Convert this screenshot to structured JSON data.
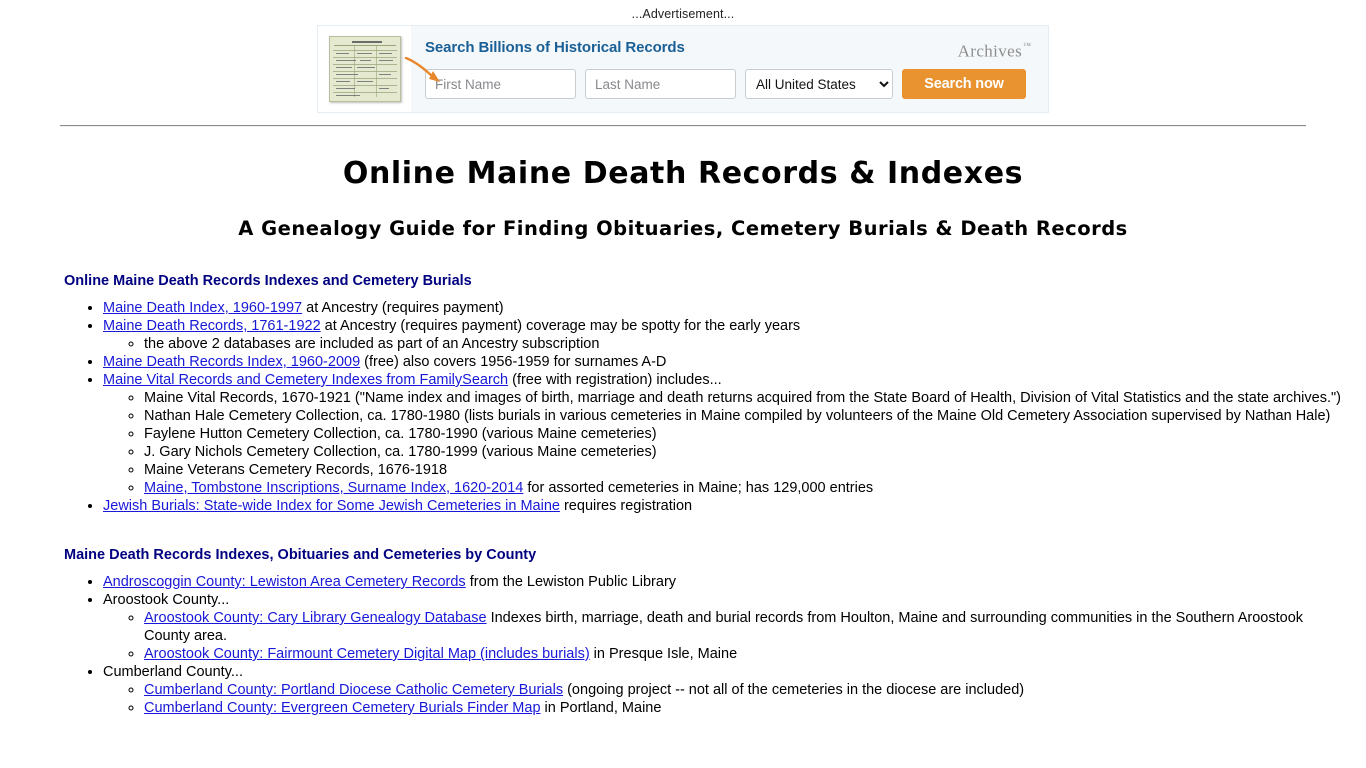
{
  "advertisement": {
    "label": "...Advertisement...",
    "headline": "Search Billions of Historical Records",
    "brand": "Archives",
    "brand_tm": "™",
    "first_name_placeholder": "First Name",
    "last_name_placeholder": "Last Name",
    "region_selected": "All United States",
    "region_options": [
      "All United States"
    ],
    "search_button": "Search now",
    "accent_color": "#e89330",
    "headline_color": "#1a6096",
    "panel_color": "#f4f8fb"
  },
  "page": {
    "title": "Online Maine Death Records & Indexes",
    "subtitle": "A Genealogy Guide for Finding Obituaries, Cemetery Burials & Death Records",
    "heading_color": "#000080",
    "link_color": "#1818d8"
  },
  "section1": {
    "heading": "Online Maine Death Records Indexes and Cemetery Burials",
    "items": [
      {
        "link": "Maine Death Index, 1960-1997",
        "text": " at Ancestry (requires payment)"
      },
      {
        "link": "Maine Death Records, 1761-1922",
        "text": " at Ancestry (requires payment) coverage may be spotty for the early years",
        "sub": [
          {
            "link": "",
            "text": "the above 2 databases are included as part of an Ancestry subscription"
          }
        ]
      },
      {
        "link": "Maine Death Records Index, 1960-2009",
        "text": " (free) also covers 1956-1959 for surnames A-D"
      },
      {
        "link": "Maine Vital Records and Cemetery Indexes from FamilySearch",
        "text": " (free with registration) includes...",
        "spaced": true,
        "sub": [
          {
            "link": "",
            "text": "Maine Vital Records, 1670-1921 (\"Name index and images of birth, marriage and death returns acquired from the State Board of Health, Division of Vital Statistics and the state archives.\")"
          },
          {
            "link": "",
            "text": "Nathan Hale Cemetery Collection, ca. 1780-1980 (lists burials in various cemeteries in Maine compiled by volunteers of the Maine Old Cemetery Association supervised by Nathan Hale)"
          },
          {
            "link": "",
            "text": "Faylene Hutton Cemetery Collection, ca. 1780-1990 (various Maine cemeteries)"
          },
          {
            "link": "",
            "text": "J. Gary Nichols Cemetery Collection, ca. 1780-1999 (various Maine cemeteries)"
          },
          {
            "link": "",
            "text": "Maine Veterans Cemetery Records, 1676-1918"
          },
          {
            "link": "Maine, Tombstone Inscriptions, Surname Index, 1620-2014",
            "text": " for assorted cemeteries in Maine; has 129,000 entries"
          }
        ]
      },
      {
        "link": "Jewish Burials: State-wide Index for Some Jewish Cemeteries in Maine",
        "text": " requires registration",
        "spaced": true
      }
    ]
  },
  "section2": {
    "heading": "Maine Death Records Indexes, Obituaries and Cemeteries by County",
    "items": [
      {
        "link": "Androscoggin County: Lewiston Area Cemetery Records",
        "text": " from the Lewiston Public Library"
      },
      {
        "link": "",
        "text": "Aroostook County...",
        "sub": [
          {
            "link": "Aroostook County: Cary Library Genealogy Database",
            "text": " Indexes birth, marriage, death and burial records from Houlton, Maine and surrounding communities in the Southern Aroostook County area."
          },
          {
            "link": "Aroostook County: Fairmount Cemetery Digital Map (includes burials)",
            "text": " in Presque Isle, Maine"
          }
        ]
      },
      {
        "link": "",
        "text": "Cumberland County...",
        "sub": [
          {
            "link": "Cumberland County: Portland Diocese Catholic Cemetery Burials",
            "text": " (ongoing project -- not all of the cemeteries in the diocese are included)"
          },
          {
            "link": "Cumberland County: Evergreen Cemetery Burials Finder Map",
            "text": " in Portland, Maine"
          }
        ]
      }
    ]
  }
}
